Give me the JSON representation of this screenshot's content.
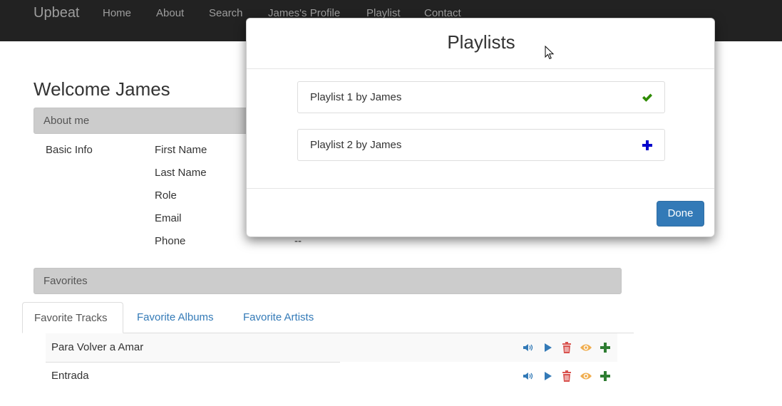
{
  "navbar": {
    "brand": "Upbeat",
    "links": [
      "Home",
      "About",
      "Search",
      "James's Profile",
      "Playlist",
      "Contact"
    ]
  },
  "page": {
    "welcome": "Welcome James",
    "about_panel_title": "About me",
    "basic_info_label": "Basic Info",
    "fields": [
      {
        "label": "First Name"
      },
      {
        "label": "Last Name"
      },
      {
        "label": "Role"
      },
      {
        "label": "Email"
      },
      {
        "label": "Phone",
        "value": "--"
      }
    ],
    "favorites_panel_title": "Favorites",
    "tabs": [
      "Favorite Tracks",
      "Favorite Albums",
      "Favorite Artists"
    ],
    "active_tab": "Favorite Tracks",
    "tracks": [
      {
        "title": "Para Volver a Amar",
        "actions": [
          "volume-icon",
          "play-icon",
          "trash-icon",
          "eye-icon",
          "plus-icon"
        ]
      },
      {
        "title": "Entrada",
        "actions": [
          "volume-icon",
          "play-icon",
          "trash-icon",
          "eye-icon",
          "plus-icon"
        ]
      }
    ]
  },
  "modal": {
    "title": "Playlists",
    "playlists": [
      {
        "name": "Playlist 1 by James",
        "icon": "check-icon",
        "icon_color": "#2e8b00"
      },
      {
        "name": "Playlist 2 by James",
        "icon": "plus-icon",
        "icon_color": "#0000cc"
      }
    ],
    "done_label": "Done"
  },
  "colors": {
    "navbar_bg": "#222222",
    "link": "#337ab7",
    "primary_button": "#337ab7",
    "trash": "#d9534f",
    "eye": "#f0ad4e",
    "add": "#2e7d32"
  }
}
